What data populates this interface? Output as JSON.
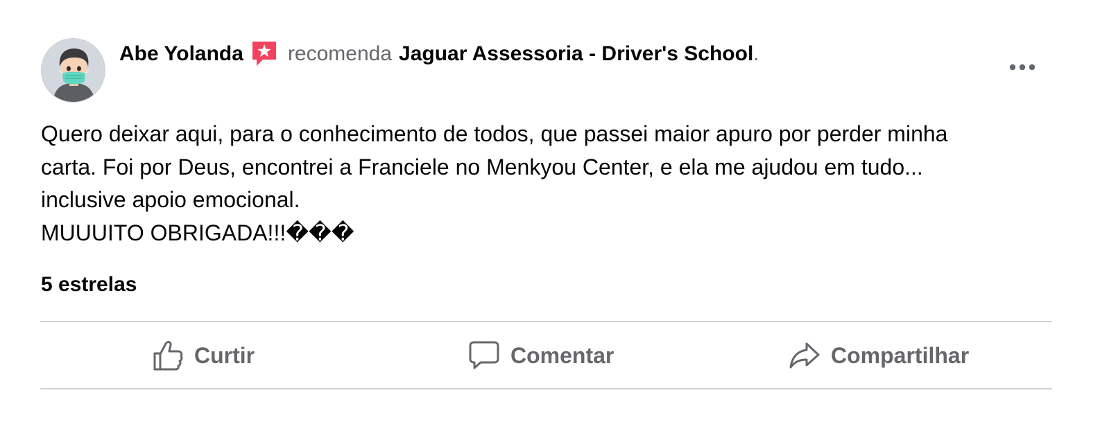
{
  "post": {
    "author": "Abe Yolanda",
    "recommends_text": "recomenda",
    "page_name": "Jaguar Assessoria - Driver's School",
    "period": ".",
    "body_lines": [
      "Quero deixar aqui, para o conhecimento de todos, que passei maior apuro por perder minha",
      "carta. Foi por Deus, encontrei a Franciele no Menkyou Center, e ela me ajudou em tudo...",
      "inclusive apoio emocional.",
      "MUUUITO OBRIGADA!!!���"
    ],
    "rating_text": "5 estrelas"
  },
  "actions": {
    "like_label": "Curtir",
    "comment_label": "Comentar",
    "share_label": "Compartilhar"
  },
  "icons": {
    "avatar": "avatar-masked-person",
    "badge": "recommendation-star-badge-icon",
    "more": "more-options-icon",
    "like": "thumbs-up-icon",
    "comment": "speech-bubble-icon",
    "share": "share-arrow-icon"
  },
  "colors": {
    "primary_text": "#050505",
    "secondary_text": "#65676b",
    "divider": "#ced0d4",
    "badge_pink": "#f3425f"
  }
}
